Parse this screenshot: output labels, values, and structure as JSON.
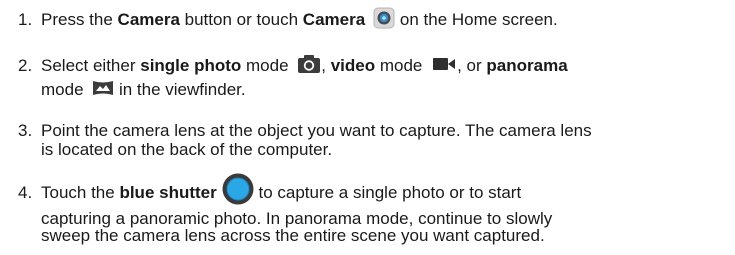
{
  "steps": [
    {
      "number": "1.",
      "t1": "Press the ",
      "b1": "Camera",
      "t2": " button or touch ",
      "b2": "Camera",
      "t3": " on the Home screen.",
      "icon": "camera-app-icon"
    },
    {
      "number": "2.",
      "t1": "Select either ",
      "b1": "single photo",
      "t2": " mode ",
      "icon1": "photo-mode-icon",
      "t3": ", ",
      "b2": "video",
      "t4": " mode ",
      "icon2": "video-mode-icon",
      "t5": ", or ",
      "b3": "panorama",
      "t6": "mode ",
      "icon3": "panorama-mode-icon",
      "t7": " in the viewfinder."
    },
    {
      "number": "3.",
      "line1": "Point the camera lens at the object you want to capture. The camera lens",
      "line2": "is located on the back of the computer."
    },
    {
      "number": "4.",
      "t1": "Touch the ",
      "b1": "blue shutter",
      "t2": " to capture a single photo or to start",
      "icon": "blue-shutter-icon",
      "line2": "capturing a panoramic photo. In panorama mode, continue to slowly",
      "line3": "sweep the camera lens across the entire scene you want captured."
    }
  ],
  "colors": {
    "text": "#1a1a1a",
    "shutter_blue": "#2aa8e6",
    "icon_dark": "#3c3c3c"
  }
}
